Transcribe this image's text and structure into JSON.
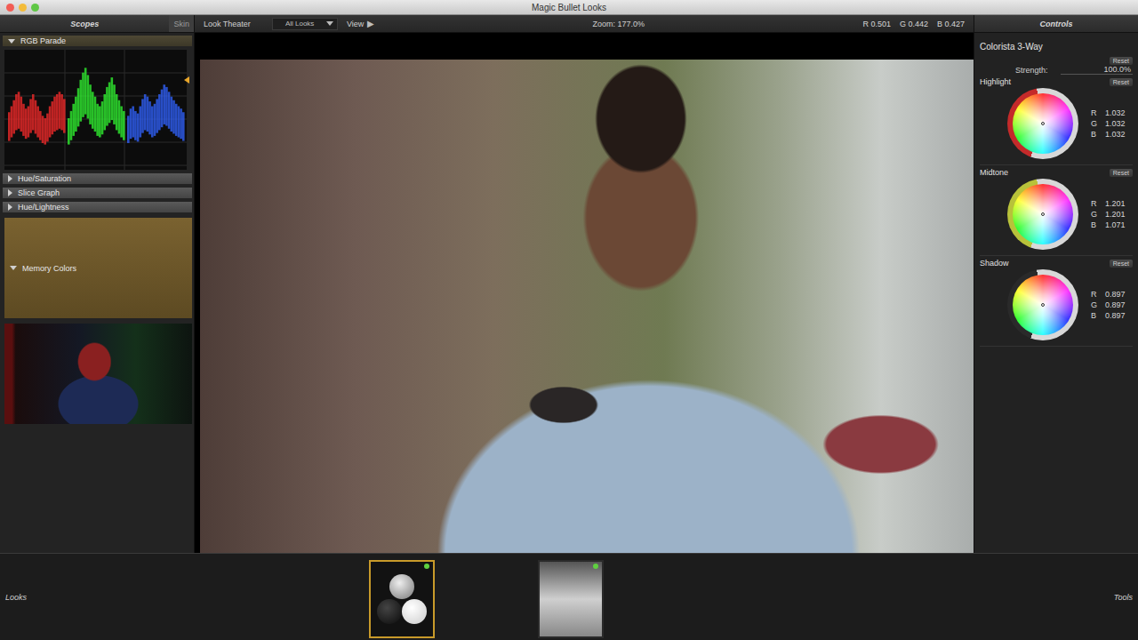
{
  "window": {
    "title": "Magic Bullet Looks"
  },
  "toolbar": {
    "scopes_tab": "Scopes",
    "skin_tab": "Skin",
    "look_theater": "Look Theater",
    "looks_filter": "All Looks",
    "view": "View",
    "play_icon": "▶",
    "zoom": "Zoom: 177.0%",
    "readout": [
      {
        "label": "R",
        "value": "0.501"
      },
      {
        "label": "G",
        "value": "0.442"
      },
      {
        "label": "B",
        "value": "0.427"
      }
    ],
    "controls_tab": "Controls"
  },
  "scopes": [
    {
      "label": "RGB Parade",
      "kind": "parade",
      "expanded": true
    },
    {
      "label": "Hue/Saturation",
      "kind": "hue-saturation",
      "expanded": false
    },
    {
      "label": "Slice Graph",
      "kind": "slice-graph",
      "expanded": false
    },
    {
      "label": "Hue/Lightness",
      "kind": "hue-lightness",
      "expanded": false
    },
    {
      "label": "Memory Colors",
      "kind": "memory-colors",
      "expanded": true
    }
  ],
  "parade": {
    "channels": [
      {
        "name": "red",
        "color": "#e02828",
        "values": [
          0.45,
          0.5,
          0.55,
          0.6,
          0.62,
          0.58,
          0.52,
          0.48,
          0.5,
          0.56,
          0.6,
          0.55,
          0.5,
          0.46,
          0.42,
          0.4,
          0.44,
          0.5,
          0.54,
          0.58,
          0.6,
          0.62,
          0.6,
          0.56
        ]
      },
      {
        "name": "green",
        "color": "#2ee02e",
        "values": [
          0.4,
          0.46,
          0.52,
          0.58,
          0.65,
          0.72,
          0.78,
          0.82,
          0.76,
          0.68,
          0.62,
          0.58,
          0.52,
          0.5,
          0.54,
          0.6,
          0.66,
          0.7,
          0.74,
          0.68,
          0.6,
          0.55,
          0.5,
          0.46
        ]
      },
      {
        "name": "blue",
        "color": "#2e5ae8",
        "values": [
          0.42,
          0.48,
          0.5,
          0.46,
          0.44,
          0.5,
          0.56,
          0.6,
          0.58,
          0.54,
          0.5,
          0.52,
          0.56,
          0.6,
          0.64,
          0.68,
          0.66,
          0.62,
          0.58,
          0.55,
          0.52,
          0.5,
          0.48,
          0.45
        ]
      }
    ]
  },
  "tool": {
    "name": "Colorista 3-Way",
    "strength_label": "Strength:",
    "strength": "100.0%",
    "reset": "Reset"
  },
  "wheels": [
    {
      "name": "Highlight",
      "color": "#c42a2a",
      "values": [
        {
          "label": "R",
          "value": "1.032"
        },
        {
          "label": "G",
          "value": "1.032"
        },
        {
          "label": "B",
          "value": "1.032"
        }
      ]
    },
    {
      "name": "Midtone",
      "color": "#b8c23a",
      "values": [
        {
          "label": "R",
          "value": "1.201"
        },
        {
          "label": "G",
          "value": "1.201"
        },
        {
          "label": "B",
          "value": "1.071"
        }
      ]
    },
    {
      "name": "Shadow",
      "color": "#2a2a2a",
      "values": [
        {
          "label": "R",
          "value": "0.897"
        },
        {
          "label": "G",
          "value": "0.897"
        },
        {
          "label": "B",
          "value": "0.897"
        }
      ]
    }
  ],
  "bottom": {
    "left": "Looks",
    "right": "Tools"
  },
  "chain": [
    {
      "kind": "three-way",
      "selected": true,
      "on": true
    },
    {
      "kind": "blank",
      "selected": false,
      "on": true
    }
  ]
}
